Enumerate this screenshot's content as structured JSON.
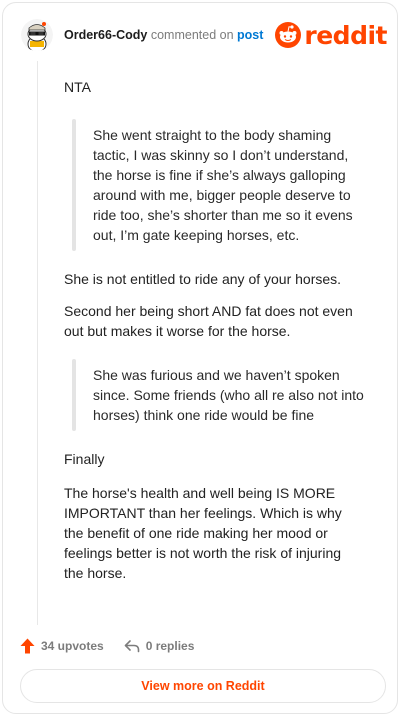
{
  "header": {
    "username": "Order66-Cody",
    "verb": "commented on",
    "target": "post",
    "brand": "reddit"
  },
  "comment": {
    "paragraph_1": "NTA",
    "quote_1": "She went straight to the body shaming tactic, I was skinny so I don’t understand, the horse is fine if she’s always galloping around with me, bigger people deserve to ride too, she’s shorter than me so it evens out, I’m gate keeping horses, etc.",
    "paragraph_2": "She is not entitled to ride any of your horses.",
    "paragraph_3": "Second her being short AND fat does not even out but makes it worse for the horse.",
    "quote_2": "She was furious and we haven’t spoken since. Some friends (who all re also not into horses) think one ride would be fine",
    "paragraph_4": "Finally",
    "paragraph_5": "The horse's health and well being IS MORE IMPORTANT than her feelings. Which is why the benefit of one ride making her mood or feelings better is not worth the risk of injuring the horse."
  },
  "footer": {
    "upvotes": "34 upvotes",
    "replies": "0 replies",
    "view_more": "View more on Reddit"
  },
  "colors": {
    "brand": "#ff4500",
    "link": "#0079d3",
    "muted": "#7c7c7c"
  },
  "icons": {
    "avatar": "snoo-avatar-icon",
    "logo": "reddit-snoo-icon",
    "upvote": "upvote-arrow-icon",
    "reply": "reply-arrow-icon"
  }
}
